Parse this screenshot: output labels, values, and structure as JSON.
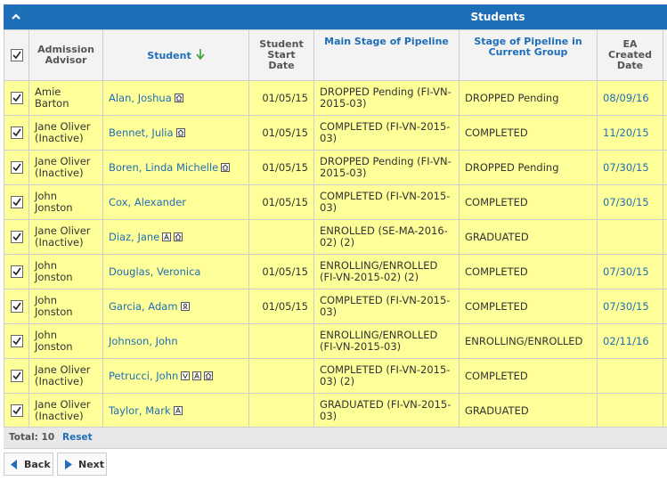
{
  "panel": {
    "title": "Students"
  },
  "columns": {
    "advisor": "Admission Advisor",
    "student": "Student",
    "start_date": "Student Start Date",
    "main_stage": "Main Stage of Pipeline",
    "group_stage": "Stage of Pipeline in Current Group",
    "ea_created": "EA Created Date"
  },
  "rows": [
    {
      "advisor": "Amie Barton",
      "student": "Alan, Joshua",
      "icons": [
        "home"
      ],
      "start_date": "01/05/15",
      "main_stage": "DROPPED Pending (FI-VN-2015-03)",
      "group_stage": "DROPPED Pending",
      "ea_created": "08/09/16"
    },
    {
      "advisor": "Jane Oliver (Inactive)",
      "student": "Bennet, Julia",
      "icons": [
        "home"
      ],
      "start_date": "01/05/15",
      "main_stage": "COMPLETED (FI-VN-2015-03)",
      "group_stage": "COMPLETED",
      "ea_created": "11/20/15"
    },
    {
      "advisor": "Jane Oliver (Inactive)",
      "student": "Boren, Linda Michelle",
      "icons": [
        "home"
      ],
      "start_date": "01/05/15",
      "main_stage": "DROPPED Pending (FI-VN-2015-03)",
      "group_stage": "DROPPED Pending",
      "ea_created": "07/30/15"
    },
    {
      "advisor": "John Jonston",
      "student": "Cox, Alexander",
      "icons": [],
      "start_date": "01/05/15",
      "main_stage": "COMPLETED (FI-VN-2015-03)",
      "group_stage": "COMPLETED",
      "ea_created": "07/30/15"
    },
    {
      "advisor": "Jane Oliver (Inactive)",
      "student": "Diaz, Jane",
      "icons": [
        "a",
        "home"
      ],
      "start_date": "",
      "main_stage": "ENROLLED (SE-MA-2016-02) (2)",
      "group_stage": "GRADUATED",
      "ea_created": ""
    },
    {
      "advisor": "John Jonston",
      "student": "Douglas, Veronica",
      "icons": [],
      "start_date": "01/05/15",
      "main_stage": "ENROLLING/ENROLLED (FI-VN-2015-02) (2)",
      "group_stage": "COMPLETED",
      "ea_created": "07/30/15"
    },
    {
      "advisor": "John Jonston",
      "student": "Garcia, Adam",
      "icons": [
        "person"
      ],
      "start_date": "01/05/15",
      "main_stage": "COMPLETED (FI-VN-2015-03)",
      "group_stage": "COMPLETED",
      "ea_created": "07/30/15"
    },
    {
      "advisor": "John Jonston",
      "student": "Johnson, John",
      "icons": [],
      "start_date": "",
      "main_stage": "ENROLLING/ENROLLED (FI-VN-2015-03)",
      "group_stage": "ENROLLING/ENROLLED",
      "ea_created": "02/11/16"
    },
    {
      "advisor": "Jane Oliver (Inactive)",
      "student": "Petrucci, John",
      "icons": [
        "v",
        "a",
        "home"
      ],
      "start_date": "",
      "main_stage": "COMPLETED (FI-VN-2015-03) (2)",
      "group_stage": "COMPLETED",
      "ea_created": ""
    },
    {
      "advisor": "Jane Oliver (Inactive)",
      "student": "Taylor, Mark",
      "icons": [
        "a"
      ],
      "start_date": "",
      "main_stage": "GRADUATED (FI-VN-2015-03)",
      "group_stage": "GRADUATED",
      "ea_created": ""
    }
  ],
  "footer": {
    "total": "Total: 10",
    "reset": "Reset"
  },
  "nav": {
    "back": "Back",
    "next": "Next"
  },
  "colors": {
    "header_blue": "#1f6eb8",
    "row_highlight": "#ffff99",
    "link": "#1f6eb8",
    "sort_arrow": "#3aa33a"
  }
}
